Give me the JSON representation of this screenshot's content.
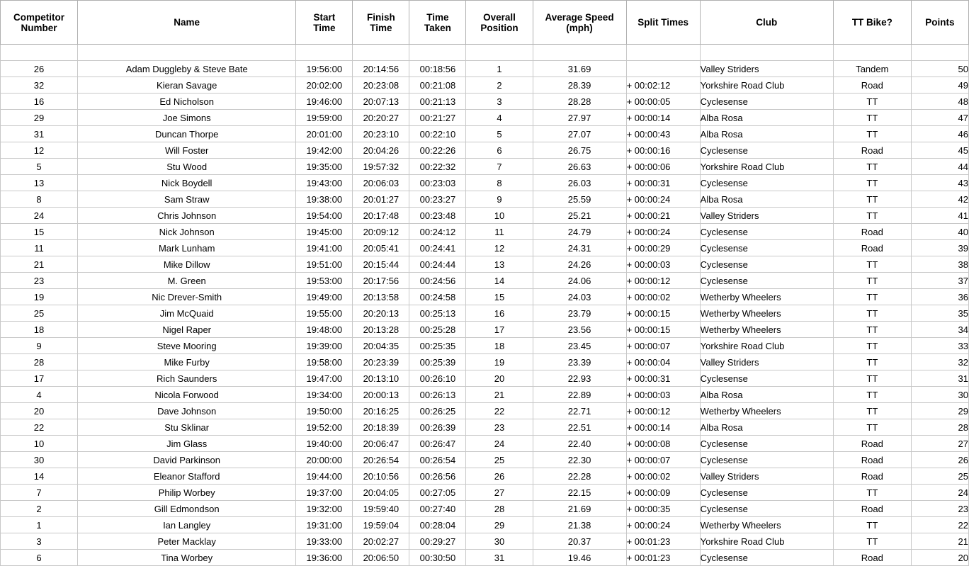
{
  "table": {
    "columns": [
      {
        "id": "competitor_number",
        "label_lines": [
          "Competitor",
          "Number"
        ],
        "align": "center"
      },
      {
        "id": "name",
        "label_lines": [
          "Name"
        ],
        "align": "center"
      },
      {
        "id": "start_time",
        "label_lines": [
          "Start",
          "Time"
        ],
        "align": "center"
      },
      {
        "id": "finish_time",
        "label_lines": [
          "Finish",
          "Time"
        ],
        "align": "center"
      },
      {
        "id": "time_taken",
        "label_lines": [
          "Time",
          "Taken"
        ],
        "align": "center"
      },
      {
        "id": "overall_position",
        "label_lines": [
          "Overall",
          "Position"
        ],
        "align": "center"
      },
      {
        "id": "average_speed",
        "label_lines": [
          "Average Speed",
          "(mph)"
        ],
        "align": "center"
      },
      {
        "id": "split_times",
        "label_lines": [
          "Split Times"
        ],
        "align": "center"
      },
      {
        "id": "club",
        "label_lines": [
          "Club"
        ],
        "align": "center"
      },
      {
        "id": "tt_bike",
        "label_lines": [
          "TT Bike?"
        ],
        "align": "center"
      },
      {
        "id": "points",
        "label_lines": [
          "Points"
        ],
        "align": "center"
      }
    ],
    "rows": [
      {
        "competitor_number": "26",
        "name": "Adam Duggleby & Steve Bate",
        "start_time": "19:56:00",
        "finish_time": "20:14:56",
        "time_taken": "00:18:56",
        "overall_position": "1",
        "average_speed": "31.69",
        "split_times": "",
        "club": "Valley Striders",
        "tt_bike": "Tandem",
        "points": "50"
      },
      {
        "competitor_number": "32",
        "name": "Kieran Savage",
        "start_time": "20:02:00",
        "finish_time": "20:23:08",
        "time_taken": "00:21:08",
        "overall_position": "2",
        "average_speed": "28.39",
        "split_times": "+ 00:02:12",
        "club": "Yorkshire Road Club",
        "tt_bike": "Road",
        "points": "49"
      },
      {
        "competitor_number": "16",
        "name": "Ed Nicholson",
        "start_time": "19:46:00",
        "finish_time": "20:07:13",
        "time_taken": "00:21:13",
        "overall_position": "3",
        "average_speed": "28.28",
        "split_times": "+ 00:00:05",
        "club": "Cyclesense",
        "tt_bike": "TT",
        "points": "48"
      },
      {
        "competitor_number": "29",
        "name": "Joe Simons",
        "start_time": "19:59:00",
        "finish_time": "20:20:27",
        "time_taken": "00:21:27",
        "overall_position": "4",
        "average_speed": "27.97",
        "split_times": "+ 00:00:14",
        "club": "Alba Rosa",
        "tt_bike": "TT",
        "points": "47"
      },
      {
        "competitor_number": "31",
        "name": "Duncan Thorpe",
        "start_time": "20:01:00",
        "finish_time": "20:23:10",
        "time_taken": "00:22:10",
        "overall_position": "5",
        "average_speed": "27.07",
        "split_times": "+ 00:00:43",
        "club": "Alba Rosa",
        "tt_bike": "TT",
        "points": "46"
      },
      {
        "competitor_number": "12",
        "name": "Will Foster",
        "start_time": "19:42:00",
        "finish_time": "20:04:26",
        "time_taken": "00:22:26",
        "overall_position": "6",
        "average_speed": "26.75",
        "split_times": "+ 00:00:16",
        "club": "Cyclesense",
        "tt_bike": "Road",
        "points": "45"
      },
      {
        "competitor_number": "5",
        "name": "Stu Wood",
        "start_time": "19:35:00",
        "finish_time": "19:57:32",
        "time_taken": "00:22:32",
        "overall_position": "7",
        "average_speed": "26.63",
        "split_times": "+ 00:00:06",
        "club": "Yorkshire Road Club",
        "tt_bike": "TT",
        "points": "44"
      },
      {
        "competitor_number": "13",
        "name": "Nick Boydell",
        "start_time": "19:43:00",
        "finish_time": "20:06:03",
        "time_taken": "00:23:03",
        "overall_position": "8",
        "average_speed": "26.03",
        "split_times": "+ 00:00:31",
        "club": "Cyclesense",
        "tt_bike": "TT",
        "points": "43"
      },
      {
        "competitor_number": "8",
        "name": "Sam Straw",
        "start_time": "19:38:00",
        "finish_time": "20:01:27",
        "time_taken": "00:23:27",
        "overall_position": "9",
        "average_speed": "25.59",
        "split_times": "+ 00:00:24",
        "club": "Alba Rosa",
        "tt_bike": "TT",
        "points": "42"
      },
      {
        "competitor_number": "24",
        "name": "Chris Johnson",
        "start_time": "19:54:00",
        "finish_time": "20:17:48",
        "time_taken": "00:23:48",
        "overall_position": "10",
        "average_speed": "25.21",
        "split_times": "+ 00:00:21",
        "club": "Valley Striders",
        "tt_bike": "TT",
        "points": "41"
      },
      {
        "competitor_number": "15",
        "name": "Nick Johnson",
        "start_time": "19:45:00",
        "finish_time": "20:09:12",
        "time_taken": "00:24:12",
        "overall_position": "11",
        "average_speed": "24.79",
        "split_times": "+ 00:00:24",
        "club": "Cyclesense",
        "tt_bike": "Road",
        "points": "40"
      },
      {
        "competitor_number": "11",
        "name": "Mark Lunham",
        "start_time": "19:41:00",
        "finish_time": "20:05:41",
        "time_taken": "00:24:41",
        "overall_position": "12",
        "average_speed": "24.31",
        "split_times": "+ 00:00:29",
        "club": "Cyclesense",
        "tt_bike": "Road",
        "points": "39"
      },
      {
        "competitor_number": "21",
        "name": "Mike Dillow",
        "start_time": "19:51:00",
        "finish_time": "20:15:44",
        "time_taken": "00:24:44",
        "overall_position": "13",
        "average_speed": "24.26",
        "split_times": "+ 00:00:03",
        "club": "Cyclesense",
        "tt_bike": "TT",
        "points": "38"
      },
      {
        "competitor_number": "23",
        "name": "M. Green",
        "start_time": "19:53:00",
        "finish_time": "20:17:56",
        "time_taken": "00:24:56",
        "overall_position": "14",
        "average_speed": "24.06",
        "split_times": "+ 00:00:12",
        "club": "Cyclesense",
        "tt_bike": "TT",
        "points": "37"
      },
      {
        "competitor_number": "19",
        "name": "Nic Drever-Smith",
        "start_time": "19:49:00",
        "finish_time": "20:13:58",
        "time_taken": "00:24:58",
        "overall_position": "15",
        "average_speed": "24.03",
        "split_times": "+ 00:00:02",
        "club": "Wetherby Wheelers",
        "tt_bike": "TT",
        "points": "36"
      },
      {
        "competitor_number": "25",
        "name": "Jim McQuaid",
        "start_time": "19:55:00",
        "finish_time": "20:20:13",
        "time_taken": "00:25:13",
        "overall_position": "16",
        "average_speed": "23.79",
        "split_times": "+ 00:00:15",
        "club": "Wetherby Wheelers",
        "tt_bike": "TT",
        "points": "35"
      },
      {
        "competitor_number": "18",
        "name": "Nigel Raper",
        "start_time": "19:48:00",
        "finish_time": "20:13:28",
        "time_taken": "00:25:28",
        "overall_position": "17",
        "average_speed": "23.56",
        "split_times": "+ 00:00:15",
        "club": "Wetherby Wheelers",
        "tt_bike": "TT",
        "points": "34"
      },
      {
        "competitor_number": "9",
        "name": "Steve Mooring",
        "start_time": "19:39:00",
        "finish_time": "20:04:35",
        "time_taken": "00:25:35",
        "overall_position": "18",
        "average_speed": "23.45",
        "split_times": "+ 00:00:07",
        "club": "Yorkshire Road Club",
        "tt_bike": "TT",
        "points": "33"
      },
      {
        "competitor_number": "28",
        "name": "Mike Furby",
        "start_time": "19:58:00",
        "finish_time": "20:23:39",
        "time_taken": "00:25:39",
        "overall_position": "19",
        "average_speed": "23.39",
        "split_times": "+ 00:00:04",
        "club": "Valley Striders",
        "tt_bike": "TT",
        "points": "32"
      },
      {
        "competitor_number": "17",
        "name": "Rich Saunders",
        "start_time": "19:47:00",
        "finish_time": "20:13:10",
        "time_taken": "00:26:10",
        "overall_position": "20",
        "average_speed": "22.93",
        "split_times": "+ 00:00:31",
        "club": "Cyclesense",
        "tt_bike": "TT",
        "points": "31"
      },
      {
        "competitor_number": "4",
        "name": "Nicola Forwood",
        "start_time": "19:34:00",
        "finish_time": "20:00:13",
        "time_taken": "00:26:13",
        "overall_position": "21",
        "average_speed": "22.89",
        "split_times": "+ 00:00:03",
        "club": "Alba Rosa",
        "tt_bike": "TT",
        "points": "30"
      },
      {
        "competitor_number": "20",
        "name": "Dave Johnson",
        "start_time": "19:50:00",
        "finish_time": "20:16:25",
        "time_taken": "00:26:25",
        "overall_position": "22",
        "average_speed": "22.71",
        "split_times": "+ 00:00:12",
        "club": "Wetherby Wheelers",
        "tt_bike": "TT",
        "points": "29"
      },
      {
        "competitor_number": "22",
        "name": "Stu Sklinar",
        "start_time": "19:52:00",
        "finish_time": "20:18:39",
        "time_taken": "00:26:39",
        "overall_position": "23",
        "average_speed": "22.51",
        "split_times": "+ 00:00:14",
        "club": "Alba Rosa",
        "tt_bike": "TT",
        "points": "28"
      },
      {
        "competitor_number": "10",
        "name": "Jim Glass",
        "start_time": "19:40:00",
        "finish_time": "20:06:47",
        "time_taken": "00:26:47",
        "overall_position": "24",
        "average_speed": "22.40",
        "split_times": "+ 00:00:08",
        "club": "Cyclesense",
        "tt_bike": "Road",
        "points": "27"
      },
      {
        "competitor_number": "30",
        "name": "David Parkinson",
        "start_time": "20:00:00",
        "finish_time": "20:26:54",
        "time_taken": "00:26:54",
        "overall_position": "25",
        "average_speed": "22.30",
        "split_times": "+ 00:00:07",
        "club": "Cyclesense",
        "tt_bike": "Road",
        "points": "26"
      },
      {
        "competitor_number": "14",
        "name": "Eleanor Stafford",
        "start_time": "19:44:00",
        "finish_time": "20:10:56",
        "time_taken": "00:26:56",
        "overall_position": "26",
        "average_speed": "22.28",
        "split_times": "+ 00:00:02",
        "club": "Valley Striders",
        "tt_bike": "Road",
        "points": "25"
      },
      {
        "competitor_number": "7",
        "name": "Philip Worbey",
        "start_time": "19:37:00",
        "finish_time": "20:04:05",
        "time_taken": "00:27:05",
        "overall_position": "27",
        "average_speed": "22.15",
        "split_times": "+ 00:00:09",
        "club": "Cyclesense",
        "tt_bike": "TT",
        "points": "24"
      },
      {
        "competitor_number": "2",
        "name": "Gill Edmondson",
        "start_time": "19:32:00",
        "finish_time": "19:59:40",
        "time_taken": "00:27:40",
        "overall_position": "28",
        "average_speed": "21.69",
        "split_times": "+ 00:00:35",
        "club": "Cyclesense",
        "tt_bike": "Road",
        "points": "23"
      },
      {
        "competitor_number": "1",
        "name": "Ian Langley",
        "start_time": "19:31:00",
        "finish_time": "19:59:04",
        "time_taken": "00:28:04",
        "overall_position": "29",
        "average_speed": "21.38",
        "split_times": "+ 00:00:24",
        "club": "Wetherby Wheelers",
        "tt_bike": "TT",
        "points": "22"
      },
      {
        "competitor_number": "3",
        "name": "Peter Macklay",
        "start_time": "19:33:00",
        "finish_time": "20:02:27",
        "time_taken": "00:29:27",
        "overall_position": "30",
        "average_speed": "20.37",
        "split_times": "+ 00:01:23",
        "club": "Yorkshire Road Club",
        "tt_bike": "TT",
        "points": "21"
      },
      {
        "competitor_number": "6",
        "name": "Tina Worbey",
        "start_time": "19:36:00",
        "finish_time": "20:06:50",
        "time_taken": "00:30:50",
        "overall_position": "31",
        "average_speed": "19.46",
        "split_times": "+ 00:01:23",
        "club": "Cyclesense",
        "tt_bike": "Road",
        "points": "20"
      }
    ]
  },
  "style": {
    "border_color": "#c8c8c8",
    "header_border_color": "#b0b0b0",
    "text_color": "#000000",
    "background": "#ffffff"
  }
}
